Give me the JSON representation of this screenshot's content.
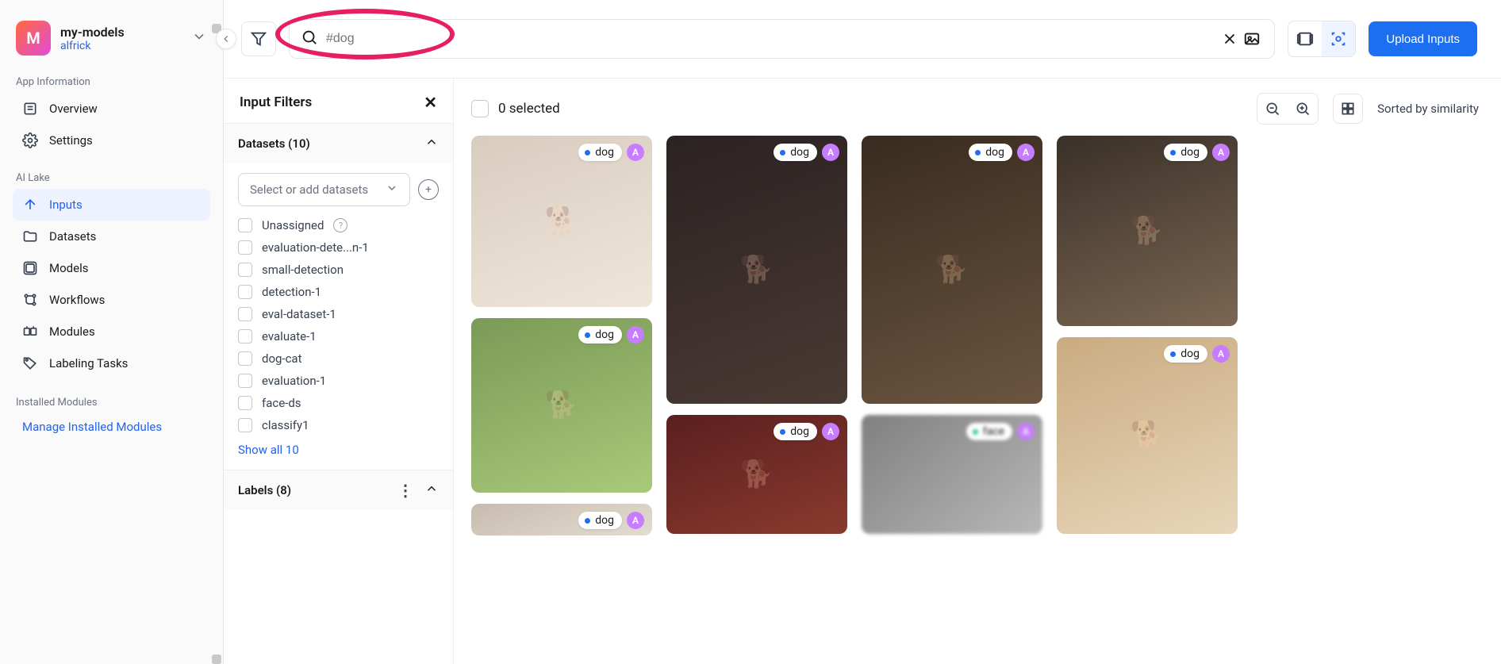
{
  "app": {
    "icon_letter": "M",
    "title": "my-models",
    "user": "alfrick"
  },
  "sidebar": {
    "section_app_info": "App Information",
    "nav_overview": "Overview",
    "nav_settings": "Settings",
    "section_ai_lake": "AI Lake",
    "nav_inputs": "Inputs",
    "nav_datasets": "Datasets",
    "nav_models": "Models",
    "nav_workflows": "Workflows",
    "nav_modules": "Modules",
    "nav_labeling": "Labeling Tasks",
    "section_installed": "Installed Modules",
    "manage_link": "Manage Installed Modules"
  },
  "search": {
    "placeholder": "#dog",
    "upload_label": "Upload Inputs"
  },
  "filters": {
    "title": "Input Filters",
    "datasets_heading": "Datasets (10)",
    "datasets_placeholder": "Select or add datasets",
    "datasets": [
      "Unassigned",
      "evaluation-dete...n-1",
      "small-detection",
      "detection-1",
      "eval-dataset-1",
      "evaluate-1",
      "dog-cat",
      "evaluation-1",
      "face-ds",
      "classify1"
    ],
    "show_all": "Show all 10",
    "labels_heading": "Labels (8)"
  },
  "results": {
    "selected_text": "0 selected",
    "sort_text": "Sorted by similarity",
    "tag_dog": "dog",
    "tag_face": "face",
    "badge_letter": "A"
  }
}
